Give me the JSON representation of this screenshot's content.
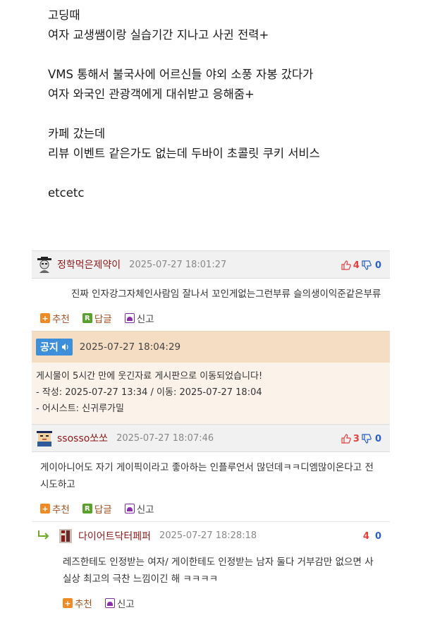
{
  "post": {
    "lines": [
      "고딩때",
      "여자 교생쌤이랑 실습기간 지나고 사귄 전력+",
      "",
      "VMS 통해서 불국사에 어르신들 야외 소풍 자봉 갔다가",
      "여자 와국인 관광객에게 대쉬받고 응해줌+",
      "",
      "카페 갔는데",
      "리뷰 이벤트 같은가도 없는데 두바이 초콜릿 쿠키 서비스",
      "",
      "etcetc"
    ]
  },
  "comments": [
    {
      "author": "정학먹은제약이",
      "date": "2025-07-27 18:01:27",
      "up": "4",
      "down": "0",
      "text": "진짜 인자강그자체인사람임 잘나서 꼬인게없는그런부류 슬의생이익준같은부류",
      "actions": {
        "recommend": "추천",
        "reply": "답글",
        "report": "신고"
      }
    },
    {
      "author": "ssosso쏘쏘",
      "date": "2025-07-27 18:07:46",
      "up": "3",
      "down": "0",
      "text": "게이아니어도 자기 게이픽이라고 좋아하는 인플루언서 많던데ㅋㅋ디엠많이온다고 전시도하고",
      "actions": {
        "recommend": "추천",
        "reply": "답글",
        "report": "신고"
      }
    }
  ],
  "notice": {
    "badge": "공지",
    "date": "2025-07-27 18:04:29",
    "line1": "게시물이 5시간 만에 웃긴자료 게시판으로 이동되었습니다!",
    "line2": "- 작성: 2025-07-27 13:34 / 이동: 2025-07-27 18:04",
    "line3": "- 어시스트: 신귀루가밀"
  },
  "reply": {
    "author": "다이어트닥터페퍼",
    "date": "2025-07-27 18:28:18",
    "up": "4",
    "down": "0",
    "text": "레즈한테도 인정받는 여자/ 게이한테도 인정받는 남자 둘다 거부감만 없으면 사실상 최고의 극찬 느낌이긴 해 ㅋㅋㅋㅋ",
    "actions": {
      "recommend": "추천",
      "report": "신고"
    }
  },
  "colors": {
    "author": "#8b1a1a",
    "up": "#e04040",
    "down": "#2b5fc7",
    "notice_bg": "#f5ddc4",
    "notice_badge": "#3c8fd8"
  }
}
